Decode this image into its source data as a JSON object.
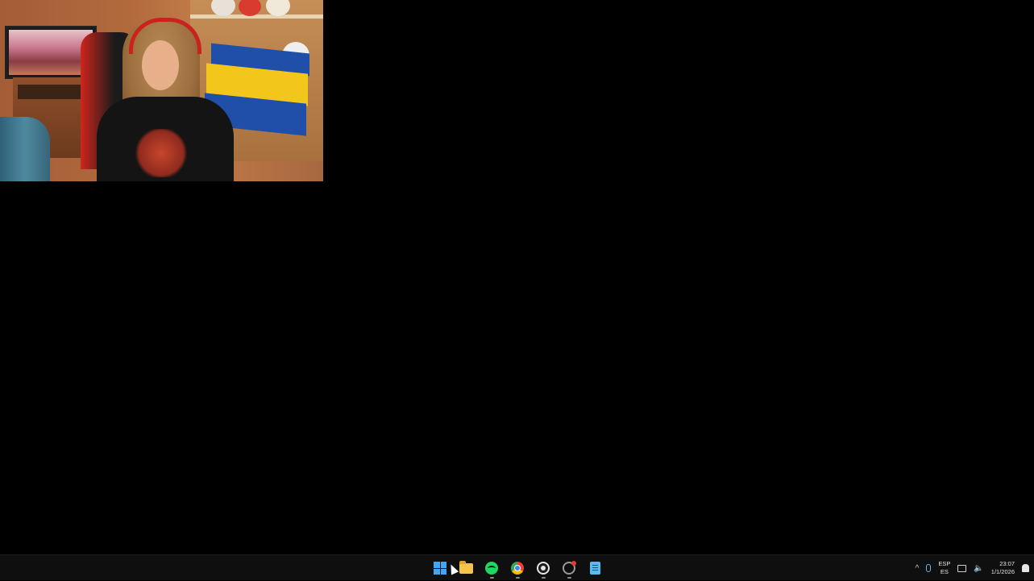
{
  "webcam": {
    "description_label": "Webcam"
  },
  "taskbar": {
    "apps": [
      {
        "name": "Start",
        "icon": "windows-logo-icon"
      },
      {
        "name": "File Explorer",
        "icon": "folder-icon"
      },
      {
        "name": "Spotify",
        "icon": "spotify-icon"
      },
      {
        "name": "Google Chrome",
        "icon": "chrome-icon"
      },
      {
        "name": "OBS Studio",
        "icon": "obs-icon"
      },
      {
        "name": "Recorder",
        "icon": "record-icon"
      },
      {
        "name": "Notepad",
        "icon": "notepad-icon"
      }
    ],
    "tray": {
      "chevron": "^",
      "lang_top": "ESP",
      "lang_bottom": "ES",
      "time": "23:07",
      "date": "1/1/2026"
    }
  },
  "colors": {
    "desktop": "#000000",
    "taskbar": "#0f0f10",
    "accent": "#3fa7f5"
  }
}
